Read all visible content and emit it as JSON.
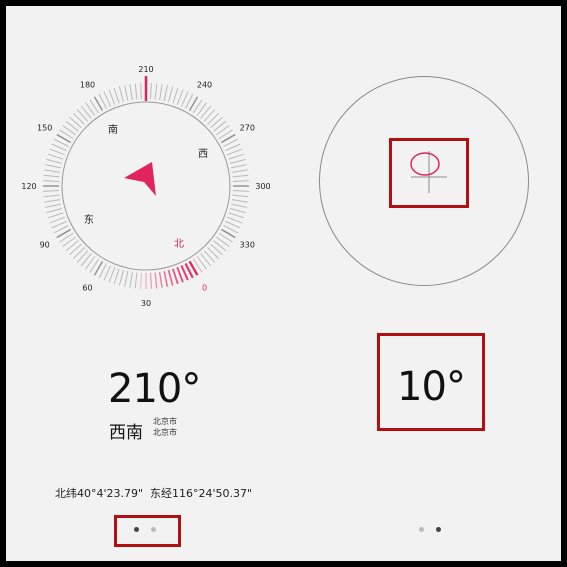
{
  "compass": {
    "ring_labels": [
      {
        "deg": 0,
        "text": "0",
        "color": "#e0245e"
      },
      {
        "deg": 30,
        "text": "30",
        "color": "#222222"
      },
      {
        "deg": 60,
        "text": "60",
        "color": "#222222"
      },
      {
        "deg": 90,
        "text": "90",
        "color": "#222222"
      },
      {
        "deg": 120,
        "text": "120",
        "color": "#222222"
      },
      {
        "deg": 150,
        "text": "150",
        "color": "#222222"
      },
      {
        "deg": 180,
        "text": "180",
        "color": "#222222"
      },
      {
        "deg": 210,
        "text": "210",
        "color": "#222222"
      },
      {
        "deg": 240,
        "text": "240",
        "color": "#222222"
      },
      {
        "deg": 270,
        "text": "270",
        "color": "#222222"
      },
      {
        "deg": 300,
        "text": "300",
        "color": "#222222"
      },
      {
        "deg": 330,
        "text": "330",
        "color": "#222222"
      }
    ],
    "cardinals": [
      {
        "deg": 0,
        "text": "北",
        "color": "#e0245e"
      },
      {
        "deg": 90,
        "text": "东",
        "color": "#222222"
      },
      {
        "deg": 180,
        "text": "南",
        "color": "#222222"
      },
      {
        "deg": 270,
        "text": "西",
        "color": "#222222"
      }
    ],
    "heading_deg": 210,
    "pointer_icon": "direction-arrow-icon",
    "accent_color": "#e0245e"
  },
  "heading": {
    "value": "210°",
    "direction": "西南",
    "city_line1": "北京市",
    "city_line2": "北京市"
  },
  "location": {
    "latitude": "北纬40°4'23.79\"",
    "longitude": "东经116°24'50.37\""
  },
  "pager": {
    "left_active_index": 0,
    "right_active_index": 1,
    "active_color": "#444444",
    "inactive_color": "#bbbbbb"
  },
  "level": {
    "icon": "level-bubble-icon",
    "tilt_value": "10°"
  },
  "highlight_color": "#b01010"
}
